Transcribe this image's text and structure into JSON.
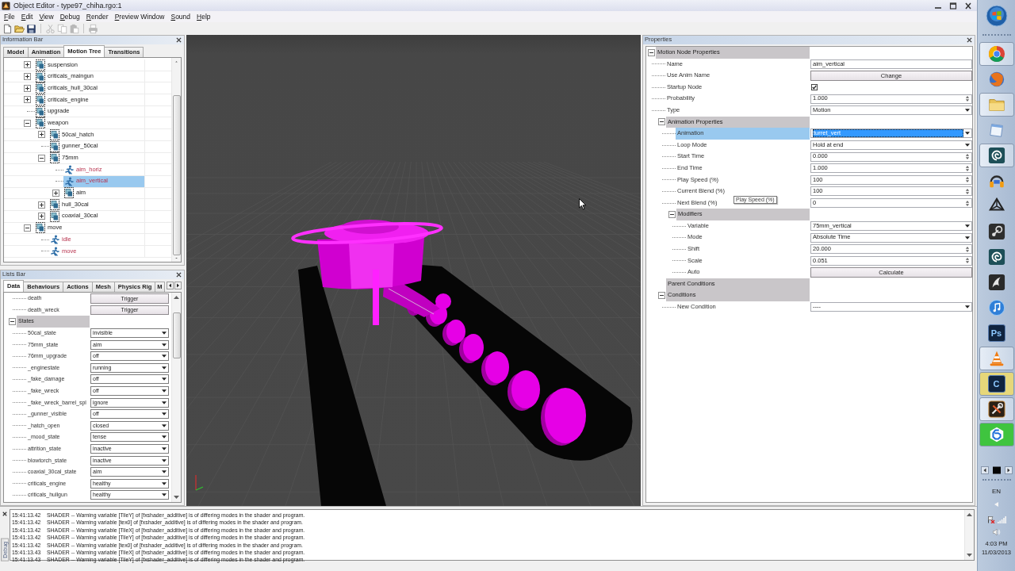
{
  "window": {
    "title": "Object Editor - type97_chiha.rgo:1"
  },
  "menu": [
    "File",
    "Edit",
    "View",
    "Debug",
    "Render",
    "Preview Window",
    "Sound",
    "Help"
  ],
  "toolbar": [
    {
      "kind": "new",
      "disabled": false
    },
    {
      "kind": "open",
      "disabled": false
    },
    {
      "kind": "save",
      "disabled": false
    },
    {
      "kind": "separator"
    },
    {
      "kind": "cut",
      "disabled": true
    },
    {
      "kind": "copy",
      "disabled": true
    },
    {
      "kind": "paste",
      "disabled": true
    },
    {
      "kind": "separator"
    },
    {
      "kind": "print",
      "disabled": true
    }
  ],
  "information_bar": {
    "title": "Information Bar",
    "tabs": [
      {
        "label": "Model",
        "selected": false
      },
      {
        "label": "Animation",
        "selected": false
      },
      {
        "label": "Motion Tree",
        "selected": true
      },
      {
        "label": "Transitions",
        "selected": false
      }
    ],
    "tree": [
      {
        "label": "suspension",
        "kind": "group",
        "expanded": false,
        "selected": false
      },
      {
        "label": "criticals_maingun",
        "kind": "group",
        "expanded": false,
        "selected": false
      },
      {
        "label": "criticals_hull_30cal",
        "kind": "group",
        "expanded": false,
        "selected": false
      },
      {
        "label": "criticals_engine",
        "kind": "group",
        "expanded": false,
        "selected": false
      },
      {
        "label": "upgrade",
        "kind": "group",
        "selected": false
      },
      {
        "label": "weapon",
        "kind": "group",
        "expanded": true,
        "selected": false,
        "children": [
          {
            "label": "50cal_hatch",
            "kind": "group",
            "expanded": false,
            "selected": false
          },
          {
            "label": "gunner_50cal",
            "kind": "group",
            "selected": false
          },
          {
            "label": "75mm",
            "kind": "group",
            "expanded": true,
            "selected": false,
            "children": [
              {
                "label": "aim_horiz",
                "kind": "motion",
                "selected": false
              },
              {
                "label": "aim_vertical",
                "kind": "motion",
                "selected": true
              },
              {
                "label": "aim",
                "kind": "group",
                "expanded": false,
                "selected": false
              }
            ]
          },
          {
            "label": "hull_30cal",
            "kind": "group",
            "expanded": false,
            "selected": false
          },
          {
            "label": "coaxial_30cal",
            "kind": "group",
            "expanded": false,
            "selected": false
          }
        ]
      },
      {
        "label": "move",
        "kind": "group",
        "expanded": true,
        "selected": false,
        "children": [
          {
            "label": "idle",
            "kind": "motion",
            "selected": false
          },
          {
            "label": "move",
            "kind": "motion",
            "selected": false
          }
        ]
      }
    ]
  },
  "lists_bar": {
    "title": "Lists Bar",
    "tabs": [
      {
        "label": "Data",
        "selected": true
      },
      {
        "label": "Behaviours",
        "selected": false
      },
      {
        "label": "Actions",
        "selected": false
      },
      {
        "label": "Mesh",
        "selected": false
      },
      {
        "label": "Physics Rig",
        "selected": false
      },
      {
        "label": "M",
        "selected": false
      }
    ],
    "rows": [
      {
        "kind": "continued",
        "children": [
          {
            "label": "death",
            "kind": "button",
            "value": "Trigger"
          },
          {
            "label": "death_wreck",
            "kind": "button",
            "value": "Trigger"
          }
        ]
      },
      {
        "kind": "category",
        "label": "States",
        "expanded": true,
        "children": [
          {
            "label": "50cal_state",
            "kind": "dropdown",
            "value": "invisible"
          },
          {
            "label": "75mm_state",
            "kind": "dropdown",
            "value": "aim"
          },
          {
            "label": "76mm_upgrade",
            "kind": "dropdown",
            "value": "off"
          },
          {
            "label": "_enginestate",
            "kind": "dropdown",
            "value": "running"
          },
          {
            "label": "_fake_damage",
            "kind": "dropdown",
            "value": "off"
          },
          {
            "label": "_fake_wreck",
            "kind": "dropdown",
            "value": "off"
          },
          {
            "label": "_fake_wreck_barrel_spl",
            "kind": "dropdown",
            "value": "ignore"
          },
          {
            "label": "_gunner_visible",
            "kind": "dropdown",
            "value": "off"
          },
          {
            "label": "_hatch_open",
            "kind": "dropdown",
            "value": "closed"
          },
          {
            "label": "_mood_state",
            "kind": "dropdown",
            "value": "tense"
          },
          {
            "label": "attrition_state",
            "kind": "dropdown",
            "value": "inactive"
          },
          {
            "label": "blowtorch_state",
            "kind": "dropdown",
            "value": "inactive"
          },
          {
            "label": "coaxial_30cal_state",
            "kind": "dropdown",
            "value": "aim"
          },
          {
            "label": "criticals_engine",
            "kind": "dropdown",
            "value": "healthy"
          },
          {
            "label": "criticals_hullgun",
            "kind": "dropdown",
            "value": "healthy"
          }
        ]
      }
    ]
  },
  "properties": {
    "title": "Properties",
    "tooltip": "Play Speed (%)",
    "rows": [
      {
        "kind": "category",
        "label": "Motion Node Properties",
        "expanded": true,
        "selected": false,
        "children": [
          {
            "label": "Name",
            "kind": "text",
            "value": "aim_vertical",
            "selected": false
          },
          {
            "label": "Use Anim Name",
            "kind": "button",
            "value": "Change",
            "selected": false
          },
          {
            "label": "Startup Node",
            "kind": "checkbox",
            "checked": true,
            "selected": false
          },
          {
            "label": "Probability",
            "kind": "spin",
            "value": "1.000",
            "selected": false
          },
          {
            "label": "Type",
            "kind": "dropdown",
            "value": "Motion",
            "selected": false
          },
          {
            "kind": "category",
            "label": "Animation Properties",
            "expanded": true,
            "selected": false,
            "children": [
              {
                "label": "Animation",
                "kind": "dropdown",
                "value": "turret_vert",
                "selected": true
              },
              {
                "label": "Loop Mode",
                "kind": "dropdown",
                "value": "Hold at end",
                "selected": false
              },
              {
                "label": "Start Time",
                "kind": "spin",
                "value": "0.000",
                "selected": false
              },
              {
                "label": "End Time",
                "kind": "spin",
                "value": "1.000",
                "selected": false
              },
              {
                "label": "Play Speed (%)",
                "kind": "spin",
                "value": "100",
                "selected": false
              },
              {
                "label": "Current Blend (%)",
                "kind": "spin",
                "value": "100",
                "selected": false
              },
              {
                "label": "Next Blend (%)",
                "kind": "spin",
                "value": "0",
                "selected": false
              },
              {
                "kind": "category",
                "label": "Modifiers",
                "expanded": true,
                "selected": false,
                "children": [
                  {
                    "label": "Variable",
                    "kind": "dropdown",
                    "value": "75mm_vertical",
                    "selected": false
                  },
                  {
                    "label": "Mode",
                    "kind": "dropdown",
                    "value": "Absolute Time",
                    "selected": false
                  },
                  {
                    "label": "Shift",
                    "kind": "spin",
                    "value": "20.000",
                    "selected": false
                  },
                  {
                    "label": "Scale",
                    "kind": "spin",
                    "value": "0.051",
                    "selected": false
                  },
                  {
                    "label": "Auto",
                    "kind": "button",
                    "value": "Calculate",
                    "selected": false
                  }
                ]
              }
            ]
          },
          {
            "kind": "category",
            "label": "Parent Conditions",
            "selected": false
          },
          {
            "kind": "category",
            "label": "Conditions",
            "expanded": true,
            "selected": false,
            "children": [
              {
                "label": "New Condition",
                "kind": "dropdown",
                "value": "----",
                "selected": false
              }
            ]
          }
        ]
      }
    ]
  },
  "debug_log": {
    "tab": "Debug",
    "lines": [
      {
        "time": "15:41:13.42",
        "message": "SHADER -- Warning variable [TileY] of [fxshader_additive] is of differing modes in the shader and program."
      },
      {
        "time": "15:41:13.42",
        "message": "SHADER -- Warning variable [tex0] of [fxshader_additive] is of differing modes in the shader and program."
      },
      {
        "time": "15:41:13.42",
        "message": "SHADER -- Warning variable [TileX] of [fxshader_additive] is of differing modes in the shader and program."
      },
      {
        "time": "15:41:13.42",
        "message": "SHADER -- Warning variable [TileY] of [fxshader_additive] is of differing modes in the shader and program."
      },
      {
        "time": "15:41:13.42",
        "message": "SHADER -- Warning variable [tex0] of [fxshader_additive] is of differing modes in the shader and program."
      },
      {
        "time": "15:41:13.43",
        "message": "SHADER -- Warning variable [TileX] of [fxshader_additive] is of differing modes in the shader and program."
      },
      {
        "time": "15:41:13.43",
        "message": "SHADER -- Warning variable [TileY] of [fxshader_additive] is of differing modes in the shader and program."
      }
    ]
  },
  "taskbar": {
    "apps": [
      {
        "kind": "wheel",
        "running": true
      },
      {
        "kind": "globe",
        "running": false
      },
      {
        "kind": "folder",
        "running": true
      },
      {
        "kind": "notepad",
        "running": false
      },
      {
        "kind": "spiral",
        "running": true
      },
      {
        "kind": "headphones",
        "running": false
      },
      {
        "kind": "cube",
        "running": false
      },
      {
        "kind": "lever",
        "running": false
      },
      {
        "kind": "spiral",
        "running": false
      },
      {
        "kind": "fin",
        "running": false
      },
      {
        "kind": "note",
        "running": false
      },
      {
        "kind": "letters",
        "label": "Ps",
        "running": false
      },
      {
        "kind": "cone",
        "running": true
      },
      {
        "kind": "letters",
        "label": "C",
        "running": true,
        "color": "#e6d77a"
      },
      {
        "kind": "wrench",
        "running": true
      },
      {
        "kind": "hexagon",
        "running": true,
        "color": "#3fc43f"
      }
    ],
    "language": "EN",
    "time": "4:03 PM",
    "date": "11/03/2013"
  }
}
